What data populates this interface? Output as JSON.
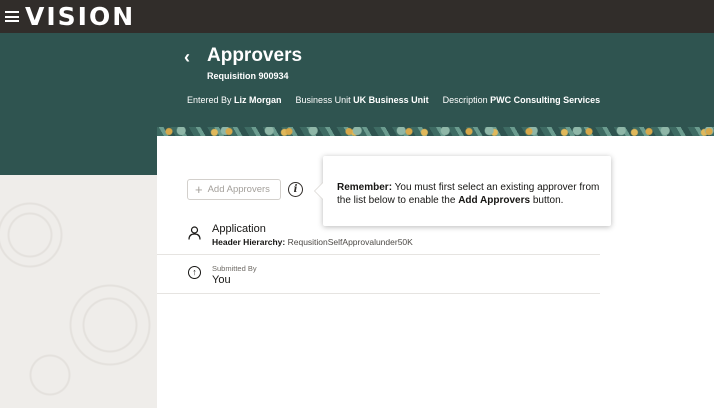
{
  "app": {
    "logo": "VISION"
  },
  "header": {
    "title": "Approvers",
    "subtitle": "Requisition 900934",
    "entered_by_label": "Entered By",
    "entered_by_value": "Liz Morgan",
    "business_unit_label": "Business Unit",
    "business_unit_value": "UK Business Unit",
    "description_label": "Description",
    "description_value": "PWC Consulting Services"
  },
  "toolbar": {
    "add_approvers_label": "Add Approvers"
  },
  "callout": {
    "lead": "Remember:",
    "text_1": " You must first select an existing approver from the list below to enable the ",
    "emphasis": "Add Approvers",
    "text_2": " button."
  },
  "approvers": [
    {
      "title": "Application",
      "sub_label": "Header Hierarchy:",
      "sub_value": " RequsitionSelfApprovalunder50K"
    },
    {
      "small": "Submitted By",
      "main": "You"
    }
  ],
  "icons": {
    "menu": "hamburger-icon",
    "back": "chevron-left-icon",
    "add": "plus-icon",
    "info": "info-icon",
    "person": "person-icon",
    "submitted": "arrow-up-circle-icon"
  }
}
